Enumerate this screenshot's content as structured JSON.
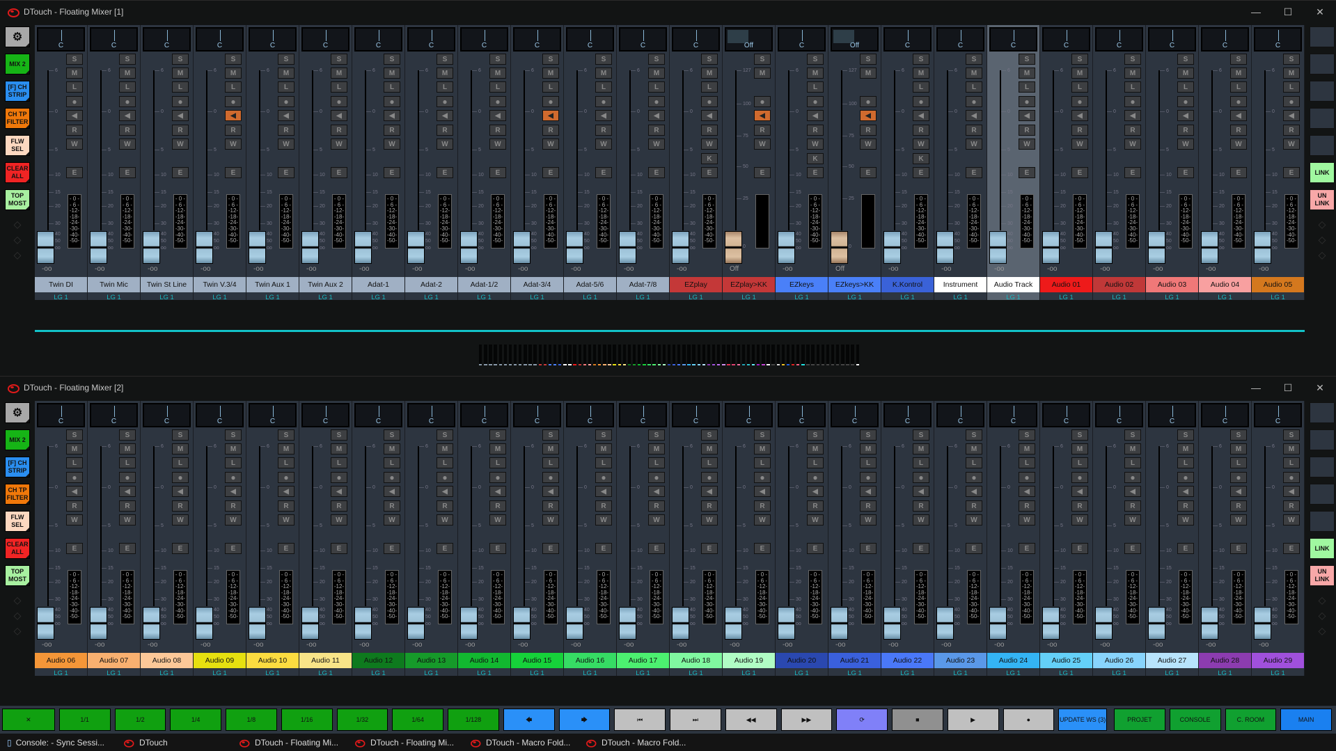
{
  "mixer1": {
    "title": "DTouch - Floating Mixer [1]",
    "left_buttons": [
      {
        "label": "⚙",
        "color": "#a8a8a8",
        "icon": "gear-icon"
      },
      {
        "label": "MIX 2",
        "color": "#16b416"
      },
      {
        "label": "[F] CH STRIP",
        "color": "#2a8ef0"
      },
      {
        "label": "CH TP FILTER",
        "color": "#f0780a"
      },
      {
        "label": "FLW SEL",
        "color": "#fcd8c0"
      },
      {
        "label": "CLEAR ALL",
        "color": "#f02424"
      },
      {
        "label": "TOP MOST",
        "color": "#a8f0a0"
      }
    ],
    "right_buttons": {
      "link": "LINK",
      "unlink": "UN LINK",
      "link_color": "#a0f8a0",
      "unlink_color": "#f8a8a8"
    },
    "channels": [
      {
        "name": "Twin DI",
        "color": "#a0b0c4",
        "pan": "C",
        "vol": "-oo",
        "lg": "LG 1",
        "mon": false
      },
      {
        "name": "Twin Mic",
        "color": "#a0b0c4",
        "pan": "C",
        "vol": "-oo",
        "lg": "LG 1",
        "mon": false
      },
      {
        "name": "Twin St Line",
        "color": "#a0b0c4",
        "pan": "C",
        "vol": "-oo",
        "lg": "LG 1",
        "mon": false
      },
      {
        "name": "Twin V.3/4",
        "color": "#a0b0c4",
        "pan": "C",
        "vol": "-oo",
        "lg": "LG 1",
        "mon": true
      },
      {
        "name": "Twin Aux 1",
        "color": "#a0b0c4",
        "pan": "C",
        "vol": "-oo",
        "lg": "LG 1",
        "mon": false
      },
      {
        "name": "Twin Aux 2",
        "color": "#a0b0c4",
        "pan": "C",
        "vol": "-oo",
        "lg": "LG 1",
        "mon": false
      },
      {
        "name": "Adat-1",
        "color": "#a0b0c4",
        "pan": "C",
        "vol": "-oo",
        "lg": "LG 1",
        "mon": false
      },
      {
        "name": "Adat-2",
        "color": "#a0b0c4",
        "pan": "C",
        "vol": "-oo",
        "lg": "LG 1",
        "mon": false
      },
      {
        "name": "Adat-1/2",
        "color": "#a0b0c4",
        "pan": "C",
        "vol": "-oo",
        "lg": "LG 1",
        "mon": false
      },
      {
        "name": "Adat-3/4",
        "color": "#a0b0c4",
        "pan": "C",
        "vol": "-oo",
        "lg": "LG 1",
        "mon": true
      },
      {
        "name": "Adat-5/6",
        "color": "#a0b0c4",
        "pan": "C",
        "vol": "-oo",
        "lg": "LG 1",
        "mon": false
      },
      {
        "name": "Adat-7/8",
        "color": "#a0b0c4",
        "pan": "C",
        "vol": "-oo",
        "lg": "LG 1",
        "mon": false
      },
      {
        "name": "EZplay",
        "color": "#c43838",
        "pan": "C",
        "vol": "-oo",
        "lg": "LG 1",
        "mon": false,
        "k": true
      },
      {
        "name": "EZplay>KK",
        "color": "#c43838",
        "pan": "Off",
        "vol": "Off",
        "lg": "LG 1",
        "mon": true,
        "midi": true
      },
      {
        "name": "EZkeys",
        "color": "#4a80f8",
        "pan": "C",
        "vol": "-oo",
        "lg": "LG 1",
        "mon": false,
        "k": true
      },
      {
        "name": "EZkeys>KK",
        "color": "#4a80f8",
        "pan": "Off",
        "vol": "Off",
        "lg": "LG 1",
        "mon": true,
        "midi": true
      },
      {
        "name": "K.Kontrol",
        "color": "#3a62d8",
        "pan": "C",
        "vol": "-oo",
        "lg": "LG 1",
        "mon": false,
        "k": true
      },
      {
        "name": "Instrument",
        "color": "#ffffff",
        "pan": "C",
        "vol": "-oo",
        "lg": "LG 1",
        "mon": false
      },
      {
        "name": "Audio Track",
        "color": "#ffffff",
        "pan": "C",
        "vol": "-oo",
        "lg": "LG 1",
        "mon": false,
        "selected": true
      },
      {
        "name": "Audio 01",
        "color": "#ee1a1a",
        "pan": "C",
        "vol": "-oo",
        "lg": "LG 1",
        "mon": false
      },
      {
        "name": "Audio 02",
        "color": "#c03838",
        "pan": "C",
        "vol": "-oo",
        "lg": "LG 1",
        "mon": false
      },
      {
        "name": "Audio 03",
        "color": "#f07878",
        "pan": "C",
        "vol": "-oo",
        "lg": "LG 1",
        "mon": false
      },
      {
        "name": "Audio 04",
        "color": "#f8a0a0",
        "pan": "C",
        "vol": "-oo",
        "lg": "LG 1",
        "mon": false
      },
      {
        "name": "Audio 05",
        "color": "#d4781e",
        "pan": "C",
        "vol": "-oo",
        "lg": "LG 1",
        "mon": false
      }
    ]
  },
  "mixer2": {
    "title": "DTouch - Floating Mixer [2]",
    "channels": [
      {
        "name": "Audio 06",
        "color": "#f49638",
        "pan": "C",
        "vol": "-oo",
        "lg": "LG 1"
      },
      {
        "name": "Audio 07",
        "color": "#f8b070",
        "pan": "C",
        "vol": "-oo",
        "lg": "LG 1"
      },
      {
        "name": "Audio 08",
        "color": "#fcc898",
        "pan": "C",
        "vol": "-oo",
        "lg": "LG 1"
      },
      {
        "name": "Audio 09",
        "color": "#e6e010",
        "pan": "C",
        "vol": "-oo",
        "lg": "LG 1"
      },
      {
        "name": "Audio 10",
        "color": "#fcdc40",
        "pan": "C",
        "vol": "-oo",
        "lg": "LG 1"
      },
      {
        "name": "Audio 11",
        "color": "#f8e488",
        "pan": "C",
        "vol": "-oo",
        "lg": "LG 1"
      },
      {
        "name": "Audio 12",
        "color": "#0e7a1e",
        "pan": "C",
        "vol": "-oo",
        "lg": "LG 1"
      },
      {
        "name": "Audio 13",
        "color": "#169a2a",
        "pan": "C",
        "vol": "-oo",
        "lg": "LG 1"
      },
      {
        "name": "Audio 14",
        "color": "#12b830",
        "pan": "C",
        "vol": "-oo",
        "lg": "LG 1"
      },
      {
        "name": "Audio 15",
        "color": "#16d23a",
        "pan": "C",
        "vol": "-oo",
        "lg": "LG 1"
      },
      {
        "name": "Audio 16",
        "color": "#36dc64",
        "pan": "C",
        "vol": "-oo",
        "lg": "LG 1"
      },
      {
        "name": "Audio 17",
        "color": "#4cf070",
        "pan": "C",
        "vol": "-oo",
        "lg": "LG 1"
      },
      {
        "name": "Audio 18",
        "color": "#80f8a0",
        "pan": "C",
        "vol": "-oo",
        "lg": "LG 1"
      },
      {
        "name": "Audio 19",
        "color": "#b0fcc4",
        "pan": "C",
        "vol": "-oo",
        "lg": "LG 1"
      },
      {
        "name": "Audio 20",
        "color": "#2a48b0",
        "pan": "C",
        "vol": "-oo",
        "lg": "LG 1"
      },
      {
        "name": "Audio 21",
        "color": "#3a60dc",
        "pan": "C",
        "vol": "-oo",
        "lg": "LG 1"
      },
      {
        "name": "Audio 22",
        "color": "#4a78f8",
        "pan": "C",
        "vol": "-oo",
        "lg": "LG 1"
      },
      {
        "name": "Audio 23",
        "color": "#5a98e8",
        "pan": "C",
        "vol": "-oo",
        "lg": "LG 1"
      },
      {
        "name": "Audio 24",
        "color": "#34b4f4",
        "pan": "C",
        "vol": "-oo",
        "lg": "LG 1"
      },
      {
        "name": "Audio 25",
        "color": "#64d0f8",
        "pan": "C",
        "vol": "-oo",
        "lg": "LG 1"
      },
      {
        "name": "Audio 26",
        "color": "#88d4fc",
        "pan": "C",
        "vol": "-oo",
        "lg": "LG 1"
      },
      {
        "name": "Audio 27",
        "color": "#b8e4fc",
        "pan": "C",
        "vol": "-oo",
        "lg": "LG 1"
      },
      {
        "name": "Audio 28",
        "color": "#8c3cb0",
        "pan": "C",
        "vol": "-oo",
        "lg": "LG 1"
      },
      {
        "name": "Audio 29",
        "color": "#a050dc",
        "pan": "C",
        "vol": "-oo",
        "lg": "LG 1"
      }
    ]
  },
  "button_labels": {
    "solo": "S",
    "mute": "M",
    "listen": "L",
    "record": "●",
    "monitor": "◀",
    "read": "R",
    "write": "W",
    "k": "K",
    "edit": "E"
  },
  "scale_audio": [
    "6",
    "0",
    "5",
    "10",
    "15",
    "20",
    "30",
    "40",
    "50",
    "oo"
  ],
  "scale_midi": [
    "127",
    "100",
    "75",
    "50",
    "25",
    "0"
  ],
  "meter_scale": [
    "- 0 -",
    "- 6 -",
    "-12-",
    "-18-",
    "-24-",
    "-30-",
    "-40-",
    "-50-"
  ],
  "minimap_colors": [
    "#8898a8",
    "#8898a8",
    "#8898a8",
    "#8898a8",
    "#8898a8",
    "#8898a8",
    "#8898a8",
    "#8898a8",
    "#8898a8",
    "#8898a8",
    "#8898a8",
    "#8898a8",
    "#c43838",
    "#c43838",
    "#4a80f8",
    "#4a80f8",
    "#3a62d8",
    "#ffffff",
    "#ffffff",
    "#ee1a1a",
    "#c03838",
    "#f07878",
    "#f8a0a0",
    "#d4781e",
    "#f49638",
    "#f8b070",
    "#fcc898",
    "#e6e010",
    "#fcdc40",
    "#f8e488",
    "#0e7a1e",
    "#169a2a",
    "#12b830",
    "#16d23a",
    "#36dc64",
    "#4cf070",
    "#80f8a0",
    "#b0fcc4",
    "#2a48b0",
    "#3a60dc",
    "#4a78f8",
    "#5a98e8",
    "#34b4f4",
    "#64d0f8",
    "#88d4fc",
    "#b8e4fc",
    "#8c3cb0",
    "#a050dc",
    "#c070f0",
    "#d090f0",
    "#e03050",
    "#e04070",
    "#f070a0",
    "#20a0b0",
    "#30c0c8",
    "#60e8f0",
    "#a020c0",
    "#c040d0",
    "#ffffff",
    "#444444",
    "#dddddd",
    "#f0c020",
    "#2060e0",
    "#e02020",
    "#f06080",
    "#20e0e0",
    "#444444",
    "#444444",
    "#444444",
    "#444444",
    "#444444",
    "#444444",
    "#444444",
    "#444444",
    "#444444",
    "#444444",
    "#ffffff"
  ],
  "transport": {
    "buttons": [
      {
        "label": "✕",
        "name": "zoom-toggle-button",
        "color": "#10a010",
        "w": 76
      },
      {
        "label": "1/1",
        "name": "grid-1-1-button",
        "color": "#10a010",
        "w": 74
      },
      {
        "label": "1/2",
        "name": "grid-1-2-button",
        "color": "#10a010",
        "w": 74
      },
      {
        "label": "1/4",
        "name": "grid-1-4-button",
        "color": "#10a010",
        "w": 74
      },
      {
        "label": "1/8",
        "name": "grid-1-8-button",
        "color": "#10a010",
        "w": 74
      },
      {
        "label": "1/16",
        "name": "grid-1-16-button",
        "color": "#10a010",
        "w": 74
      },
      {
        "label": "1/32",
        "name": "grid-1-32-button",
        "color": "#10a010",
        "w": 74
      },
      {
        "label": "1/64",
        "name": "grid-1-64-button",
        "color": "#10a010",
        "w": 74
      },
      {
        "label": "1/128",
        "name": "grid-1-128-button",
        "color": "#10a010",
        "w": 74
      },
      {
        "label": "🡄",
        "name": "nudge-left-button",
        "color": "#2a90f8",
        "w": 74
      },
      {
        "label": "🡆",
        "name": "nudge-right-button",
        "color": "#2a90f8",
        "w": 74
      },
      {
        "label": "⏮",
        "name": "prev-marker-button",
        "color": "#c0c0c0",
        "w": 74
      },
      {
        "label": "⏭",
        "name": "next-marker-button",
        "color": "#c0c0c0",
        "w": 74
      },
      {
        "label": "◀◀",
        "name": "rewind-button",
        "color": "#c0c0c0",
        "w": 74
      },
      {
        "label": "▶▶",
        "name": "fast-forward-button",
        "color": "#c0c0c0",
        "w": 74
      },
      {
        "label": "⟳",
        "name": "cycle-button",
        "color": "#8080f8",
        "w": 74
      },
      {
        "label": "■",
        "name": "stop-button",
        "color": "#909090",
        "w": 74
      },
      {
        "label": "▶",
        "name": "play-button",
        "color": "#c0c0c0",
        "w": 74
      },
      {
        "label": "●",
        "name": "record-button",
        "color": "#c0c0c0",
        "w": 74
      },
      {
        "label": "UPDATE WS (3)",
        "name": "update-ws-button",
        "color": "#2a90f8",
        "w": 70
      },
      {
        "label": "PROJET",
        "name": "projet-button",
        "color": "#10a030",
        "w": 74
      },
      {
        "label": "CONSOLE",
        "name": "console-button",
        "color": "#10a030",
        "w": 74
      },
      {
        "label": "C. ROOM",
        "name": "control-room-button",
        "color": "#10a030",
        "w": 74
      },
      {
        "label": "MAIN",
        "name": "main-button",
        "color": "#1a80f0",
        "w": 74
      }
    ]
  },
  "taskbar": {
    "items": [
      {
        "label": "Console: - Sync Sessi...",
        "icon": "document-icon"
      },
      {
        "label": "DTouch",
        "icon": "dtouch-icon"
      },
      {
        "label": "DTouch - Floating Mi...",
        "icon": "dtouch-icon"
      },
      {
        "label": "DTouch - Floating Mi...",
        "icon": "dtouch-icon"
      },
      {
        "label": "DTouch - Macro Fold...",
        "icon": "dtouch-icon"
      },
      {
        "label": "DTouch - Macro Fold...",
        "icon": "dtouch-icon"
      }
    ]
  }
}
